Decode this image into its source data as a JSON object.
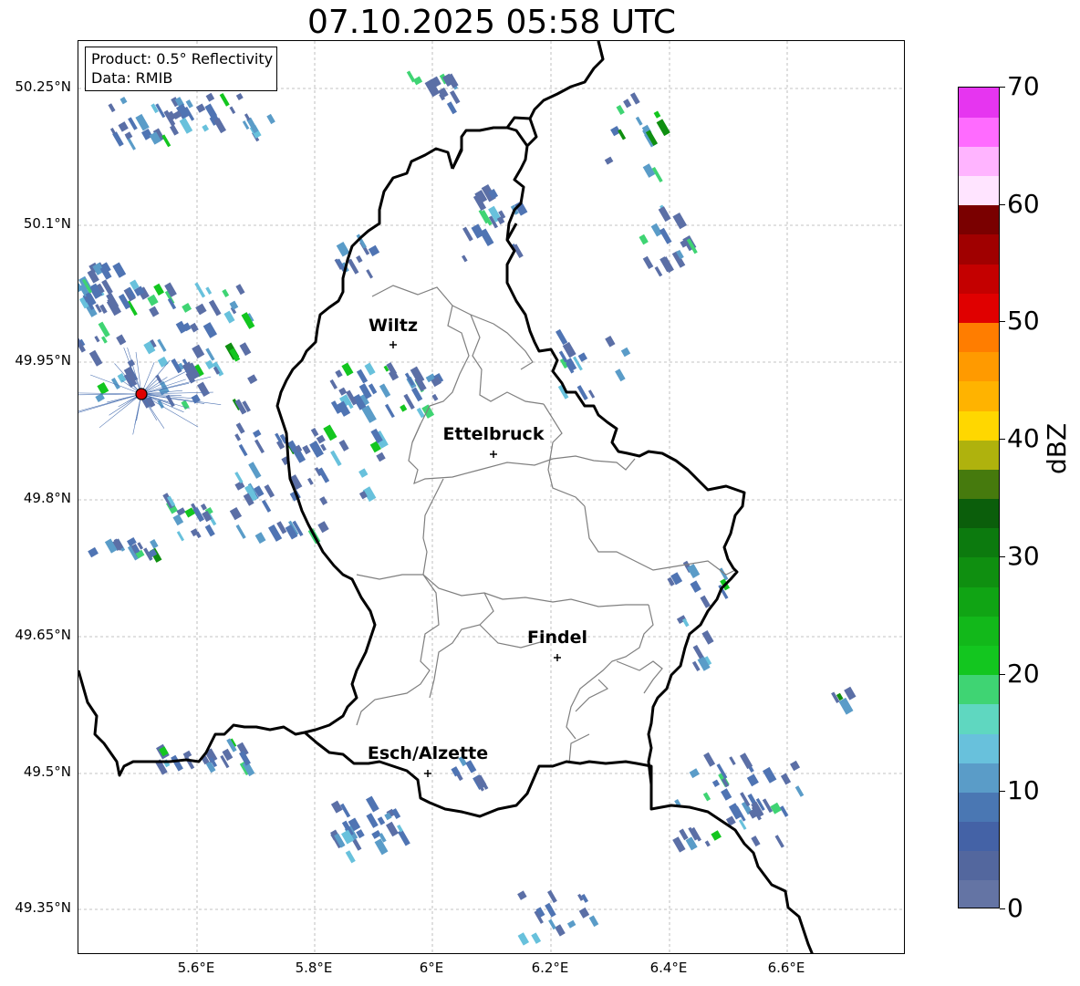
{
  "title": "07.10.2025 05:58 UTC",
  "info": {
    "product": "Product: 0.5° Reflectivity",
    "source": "Data: RMIB"
  },
  "lat_labels": [
    "50.25°N",
    "50.1°N",
    "49.95°N",
    "49.8°N",
    "49.65°N",
    "49.5°N",
    "49.35°N"
  ],
  "lon_labels": [
    "5.6°E",
    "5.8°E",
    "6°E",
    "6.2°E",
    "6.4°E",
    "6.6°E"
  ],
  "cities": [
    "Wiltz",
    "Ettelbruck",
    "Findel",
    "Esch/Alzette"
  ],
  "colorbar": {
    "unit": "dBZ",
    "tick_labels": [
      "0",
      "10",
      "20",
      "30",
      "40",
      "50",
      "60",
      "70"
    ],
    "colors": [
      "#6474a4",
      "#53679e",
      "#4462a6",
      "#4a77b3",
      "#5a9cc8",
      "#68c1dc",
      "#5fd7c0",
      "#3fd473",
      "#13c61f",
      "#12b81a",
      "#10a414",
      "#0f8f10",
      "#0c7a0e",
      "#0b5e0b",
      "#467a0d",
      "#afb20d",
      "#ffd700",
      "#ffb300",
      "#ff9a00",
      "#ff7d00",
      "#e00000",
      "#c40000",
      "#a00000",
      "#7a0000",
      "#ffe4ff",
      "#ffb4ff",
      "#ff6bff",
      "#e635f0"
    ]
  },
  "colors": {
    "border": "#000000",
    "district": "#7f7f7f",
    "grid": "#b0b0b0",
    "radar_site": "#e00000"
  }
}
